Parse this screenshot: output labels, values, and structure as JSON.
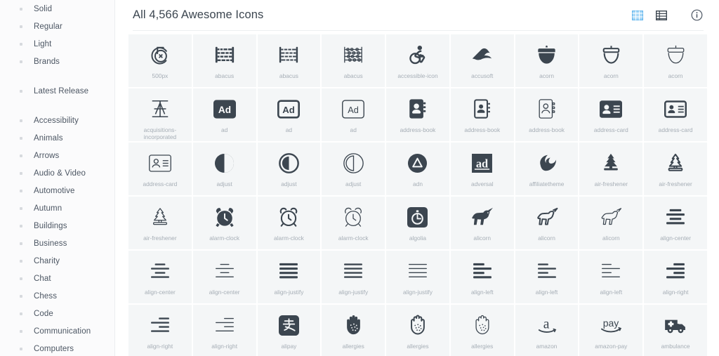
{
  "sidebar": {
    "groups": [
      {
        "items": [
          {
            "label": "Solid"
          },
          {
            "label": "Regular"
          },
          {
            "label": "Light"
          },
          {
            "label": "Brands"
          }
        ]
      },
      {
        "items": [
          {
            "label": "Latest Release"
          }
        ]
      },
      {
        "items": [
          {
            "label": "Accessibility"
          },
          {
            "label": "Animals"
          },
          {
            "label": "Arrows"
          },
          {
            "label": "Audio & Video"
          },
          {
            "label": "Automotive"
          },
          {
            "label": "Autumn"
          },
          {
            "label": "Buildings"
          },
          {
            "label": "Business"
          },
          {
            "label": "Charity"
          },
          {
            "label": "Chat"
          },
          {
            "label": "Chess"
          },
          {
            "label": "Code"
          },
          {
            "label": "Communication"
          },
          {
            "label": "Computers"
          }
        ]
      }
    ]
  },
  "header": {
    "title": "All 4,566 Awesome Icons",
    "actions": [
      {
        "name": "grid-view-icon",
        "label": "Grid view",
        "active": true,
        "color": "#8ecbf5"
      },
      {
        "name": "list-view-icon",
        "label": "List view",
        "active": false,
        "color": "#3c4650"
      },
      {
        "name": "info-icon",
        "label": "Information",
        "active": false,
        "color": "#4c5663"
      }
    ]
  },
  "colors": {
    "glyph": "#3c4650",
    "cell_background": "#f4f6f7",
    "cell_label": "#a6aeb6",
    "sidebar_background": "#fbfbfc",
    "accent_active": "#8ecbf5"
  },
  "grid": {
    "columns": 9,
    "icons": [
      {
        "id": "500px",
        "label": "500px",
        "style": "brands"
      },
      {
        "id": "abacus-s",
        "label": "abacus",
        "style": "solid"
      },
      {
        "id": "abacus-r",
        "label": "abacus",
        "style": "regular"
      },
      {
        "id": "abacus-l",
        "label": "abacus",
        "style": "light"
      },
      {
        "id": "accessible-icon",
        "label": "accessible-icon",
        "style": "brands"
      },
      {
        "id": "accusoft",
        "label": "accusoft",
        "style": "brands"
      },
      {
        "id": "acorn-s",
        "label": "acorn",
        "style": "solid"
      },
      {
        "id": "acorn-r",
        "label": "acorn",
        "style": "regular"
      },
      {
        "id": "acorn-l",
        "label": "acorn",
        "style": "light"
      },
      {
        "id": "acquisitions-incorporated",
        "label": "acquisitions-incorporated",
        "style": "brands"
      },
      {
        "id": "ad-s",
        "label": "ad",
        "style": "solid"
      },
      {
        "id": "ad-r",
        "label": "ad",
        "style": "regular"
      },
      {
        "id": "ad-l",
        "label": "ad",
        "style": "light"
      },
      {
        "id": "address-book-s",
        "label": "address-book",
        "style": "solid"
      },
      {
        "id": "address-book-r",
        "label": "address-book",
        "style": "regular"
      },
      {
        "id": "address-book-l",
        "label": "address-book",
        "style": "light"
      },
      {
        "id": "address-card-s",
        "label": "address-card",
        "style": "solid"
      },
      {
        "id": "address-card-r",
        "label": "address-card",
        "style": "regular"
      },
      {
        "id": "address-card-l",
        "label": "address-card",
        "style": "light"
      },
      {
        "id": "adjust-s",
        "label": "adjust",
        "style": "solid"
      },
      {
        "id": "adjust-r",
        "label": "adjust",
        "style": "regular"
      },
      {
        "id": "adjust-l",
        "label": "adjust",
        "style": "light"
      },
      {
        "id": "adn",
        "label": "adn",
        "style": "brands"
      },
      {
        "id": "adversal",
        "label": "adversal",
        "style": "brands"
      },
      {
        "id": "affiliatetheme",
        "label": "affiliatetheme",
        "style": "brands"
      },
      {
        "id": "air-freshener-s",
        "label": "air-freshener",
        "style": "solid"
      },
      {
        "id": "air-freshener-r",
        "label": "air-freshener",
        "style": "regular"
      },
      {
        "id": "air-freshener-l",
        "label": "air-freshener",
        "style": "light"
      },
      {
        "id": "alarm-clock-s",
        "label": "alarm-clock",
        "style": "solid"
      },
      {
        "id": "alarm-clock-r",
        "label": "alarm-clock",
        "style": "regular"
      },
      {
        "id": "alarm-clock-l",
        "label": "alarm-clock",
        "style": "light"
      },
      {
        "id": "algolia",
        "label": "algolia",
        "style": "brands"
      },
      {
        "id": "alicorn-s",
        "label": "alicorn",
        "style": "solid"
      },
      {
        "id": "alicorn-r",
        "label": "alicorn",
        "style": "regular"
      },
      {
        "id": "alicorn-l",
        "label": "alicorn",
        "style": "light"
      },
      {
        "id": "align-center-s",
        "label": "align-center",
        "style": "solid"
      },
      {
        "id": "align-center-r",
        "label": "align-center",
        "style": "regular"
      },
      {
        "id": "align-center-l",
        "label": "align-center",
        "style": "light"
      },
      {
        "id": "align-justify-s",
        "label": "align-justify",
        "style": "solid"
      },
      {
        "id": "align-justify-r",
        "label": "align-justify",
        "style": "regular"
      },
      {
        "id": "align-justify-l",
        "label": "align-justify",
        "style": "light"
      },
      {
        "id": "align-left-s",
        "label": "align-left",
        "style": "solid"
      },
      {
        "id": "align-left-r",
        "label": "align-left",
        "style": "regular"
      },
      {
        "id": "align-left-l",
        "label": "align-left",
        "style": "light"
      },
      {
        "id": "align-right-s",
        "label": "align-right",
        "style": "solid"
      },
      {
        "id": "align-right-r",
        "label": "align-right",
        "style": "regular"
      },
      {
        "id": "align-right-l",
        "label": "align-right",
        "style": "light"
      },
      {
        "id": "alipay",
        "label": "alipay",
        "style": "brands"
      },
      {
        "id": "allergies-s",
        "label": "allergies",
        "style": "solid"
      },
      {
        "id": "allergies-r",
        "label": "allergies",
        "style": "regular"
      },
      {
        "id": "allergies-l",
        "label": "allergies",
        "style": "light"
      },
      {
        "id": "amazon",
        "label": "amazon",
        "style": "brands"
      },
      {
        "id": "amazon-pay",
        "label": "amazon-pay",
        "style": "brands"
      },
      {
        "id": "ambulance",
        "label": "ambulance",
        "style": "solid"
      }
    ]
  }
}
